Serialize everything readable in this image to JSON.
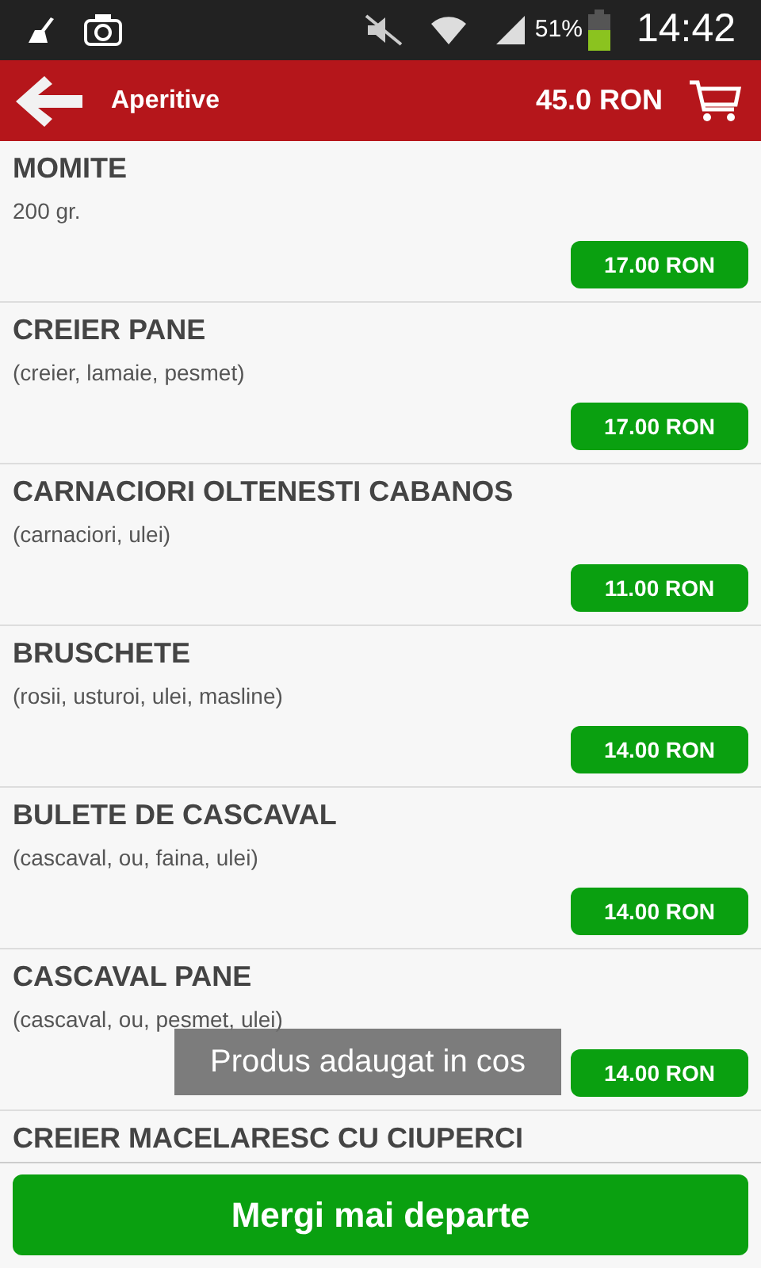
{
  "status_bar": {
    "battery": "51%",
    "time": "14:42"
  },
  "header": {
    "title": "Aperitive",
    "total": "45.0 RON"
  },
  "items": [
    {
      "name": "MOMITE",
      "description": "200 gr.",
      "price": "17.00 RON"
    },
    {
      "name": "CREIER PANE",
      "description": "(creier, lamaie, pesmet)",
      "price": "17.00 RON"
    },
    {
      "name": "CARNACIORI OLTENESTI CABANOS",
      "description": "(carnaciori, ulei)",
      "price": "11.00 RON"
    },
    {
      "name": "BRUSCHETE",
      "description": "(rosii, usturoi, ulei, masline)",
      "price": "14.00 RON"
    },
    {
      "name": "BULETE DE CASCAVAL",
      "description": "(cascaval, ou, faina, ulei)",
      "price": "14.00 RON"
    },
    {
      "name": "CASCAVAL PANE",
      "description": "(cascaval, ou, pesmet, ulei)",
      "price": "14.00 RON"
    },
    {
      "name": "CREIER MACELARESC CU CIUPERCI"
    }
  ],
  "toast": "Produs adaugat in cos",
  "continue_button": "Mergi mai departe"
}
